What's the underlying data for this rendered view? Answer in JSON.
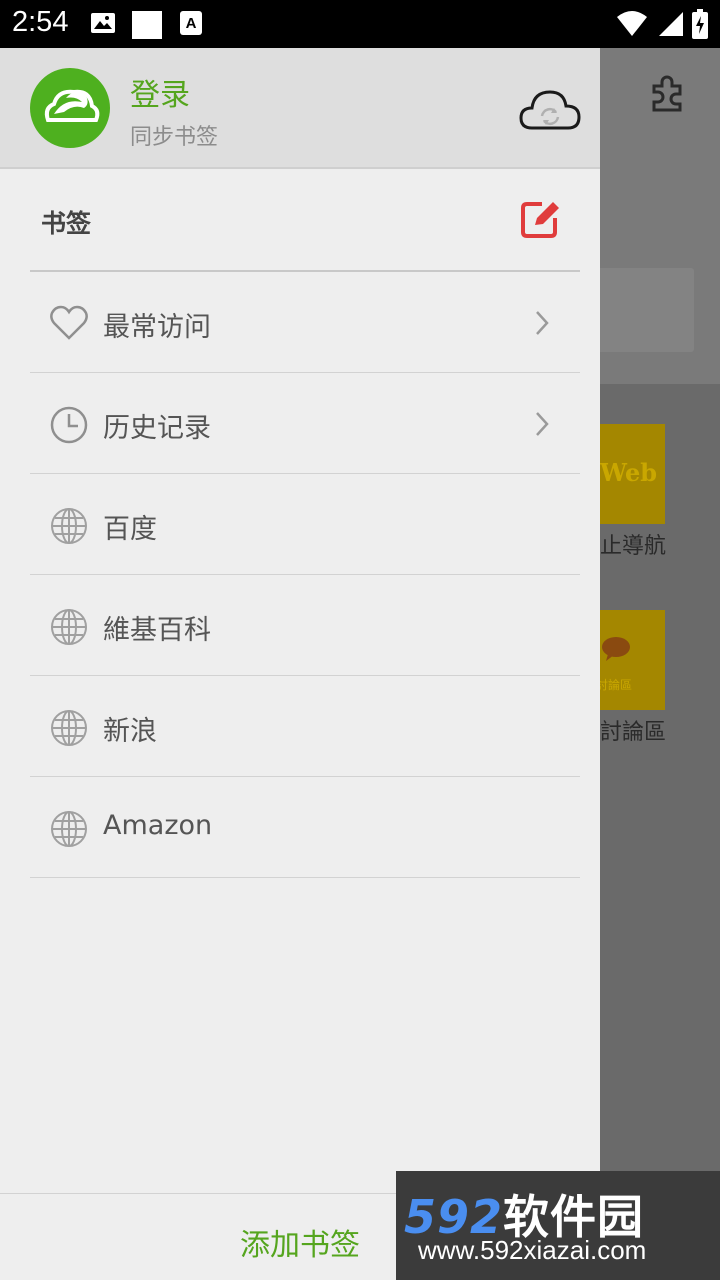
{
  "status_bar": {
    "time": "2:54"
  },
  "drawer": {
    "header": {
      "login_title": "登录",
      "login_subtitle": "同步书签"
    },
    "section_title": "书签",
    "items": [
      {
        "label": "最常访问",
        "icon": "heart-icon",
        "has_chevron": true
      },
      {
        "label": "历史记录",
        "icon": "clock-icon",
        "has_chevron": true
      },
      {
        "label": "百度",
        "icon": "globe-icon",
        "has_chevron": false
      },
      {
        "label": "維基百科",
        "icon": "globe-icon",
        "has_chevron": false
      },
      {
        "label": "新浪",
        "icon": "globe-icon",
        "has_chevron": false
      },
      {
        "label": "Amazon",
        "icon": "globe-icon",
        "has_chevron": false
      }
    ],
    "footer_button": "添加书签"
  },
  "background_page": {
    "tile1_text": "Web",
    "tile1_label": "止導航",
    "tile2_text": "討論區",
    "tile2_label": "討論區"
  },
  "watermark": {
    "brand_num": "592",
    "brand_cn": "软件园",
    "url": "www.592xiazai.com"
  },
  "colors": {
    "accent_green": "#55a51e",
    "edit_red": "#e03c3c",
    "drawer_bg": "#eeeeee",
    "header_bg": "#dedede"
  }
}
